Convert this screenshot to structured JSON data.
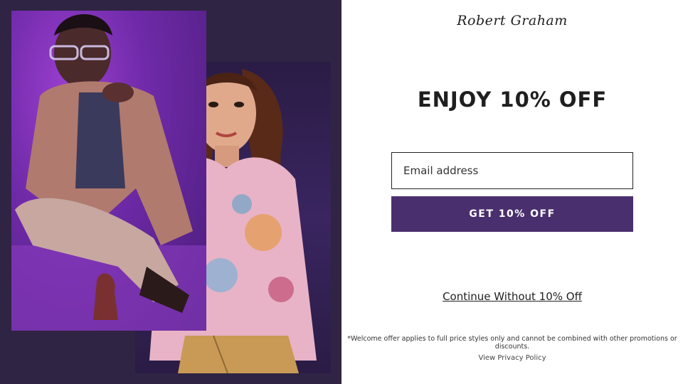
{
  "brand": {
    "logo_text": "Robert Graham"
  },
  "offer": {
    "headline": "ENJOY 10% OFF",
    "email_placeholder": "Email address",
    "cta_label": "GET 10% OFF",
    "continue_label": "Continue Without 10% Off",
    "disclaimer": "*Welcome offer applies to full price styles only and cannot be combined with other promotions or discounts.",
    "privacy_label": "View Privacy Policy"
  },
  "colors": {
    "cta_bg": "#4a2f6e",
    "left_panel_bg": "#2f2443",
    "photo_purple": "#6f2aa8"
  }
}
